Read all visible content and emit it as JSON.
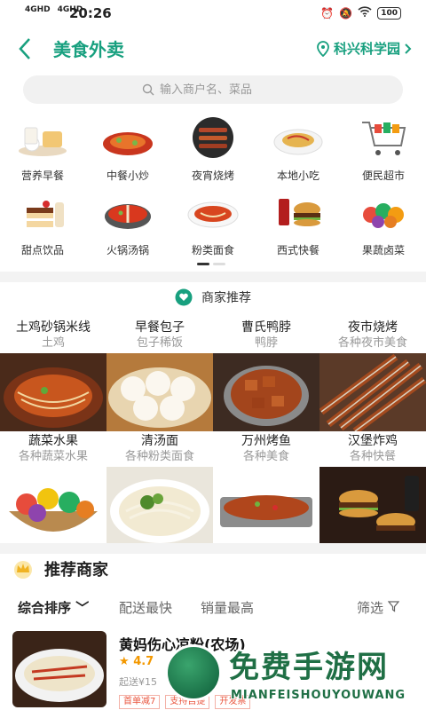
{
  "status_bar": {
    "net1": "4GHD",
    "net2": "4GHD",
    "time": "20:26",
    "battery": "100"
  },
  "header": {
    "title": "美食外卖",
    "location": "科兴科学园"
  },
  "search": {
    "placeholder": "输入商户名、菜品"
  },
  "categories": [
    {
      "label": "营养早餐"
    },
    {
      "label": "中餐小炒"
    },
    {
      "label": "夜宵烧烤"
    },
    {
      "label": "本地小吃"
    },
    {
      "label": "便民超市"
    },
    {
      "label": "甜点饮品"
    },
    {
      "label": "火锅汤锅"
    },
    {
      "label": "粉类面食"
    },
    {
      "label": "西式快餐"
    },
    {
      "label": "果蔬卤菜"
    }
  ],
  "merchant_recommend": {
    "title": "商家推荐",
    "tiles": [
      {
        "name": "土鸡砂锅米线",
        "sub": "土鸡"
      },
      {
        "name": "早餐包子",
        "sub": "包子稀饭"
      },
      {
        "name": "曹氏鸭脖",
        "sub": "鸭脖"
      },
      {
        "name": "夜市烧烤",
        "sub": "各种夜市美食"
      },
      {
        "name": "蔬菜水果",
        "sub": "各种蔬菜水果"
      },
      {
        "name": "清汤面",
        "sub": "各种粉类面食"
      },
      {
        "name": "万州烤鱼",
        "sub": "各种美食"
      },
      {
        "name": "汉堡炸鸡",
        "sub": "各种快餐"
      }
    ]
  },
  "recommended_merchants": {
    "title": "推荐商家",
    "sorts": {
      "comprehensive": "综合排序",
      "fastest": "配送最快",
      "top_sales": "销量最高",
      "filter": "筛选"
    },
    "store": {
      "name": "黄妈伤心凉粉(农场)",
      "rating": "4.7",
      "meta": "起送¥15",
      "tags": [
        "首单减7",
        "支持自提",
        "开发票"
      ]
    }
  },
  "watermark": {
    "cn": "免费手游网",
    "en": "MIANFEISHOUYOUWANG"
  },
  "colors": {
    "accent": "#18a07f"
  }
}
